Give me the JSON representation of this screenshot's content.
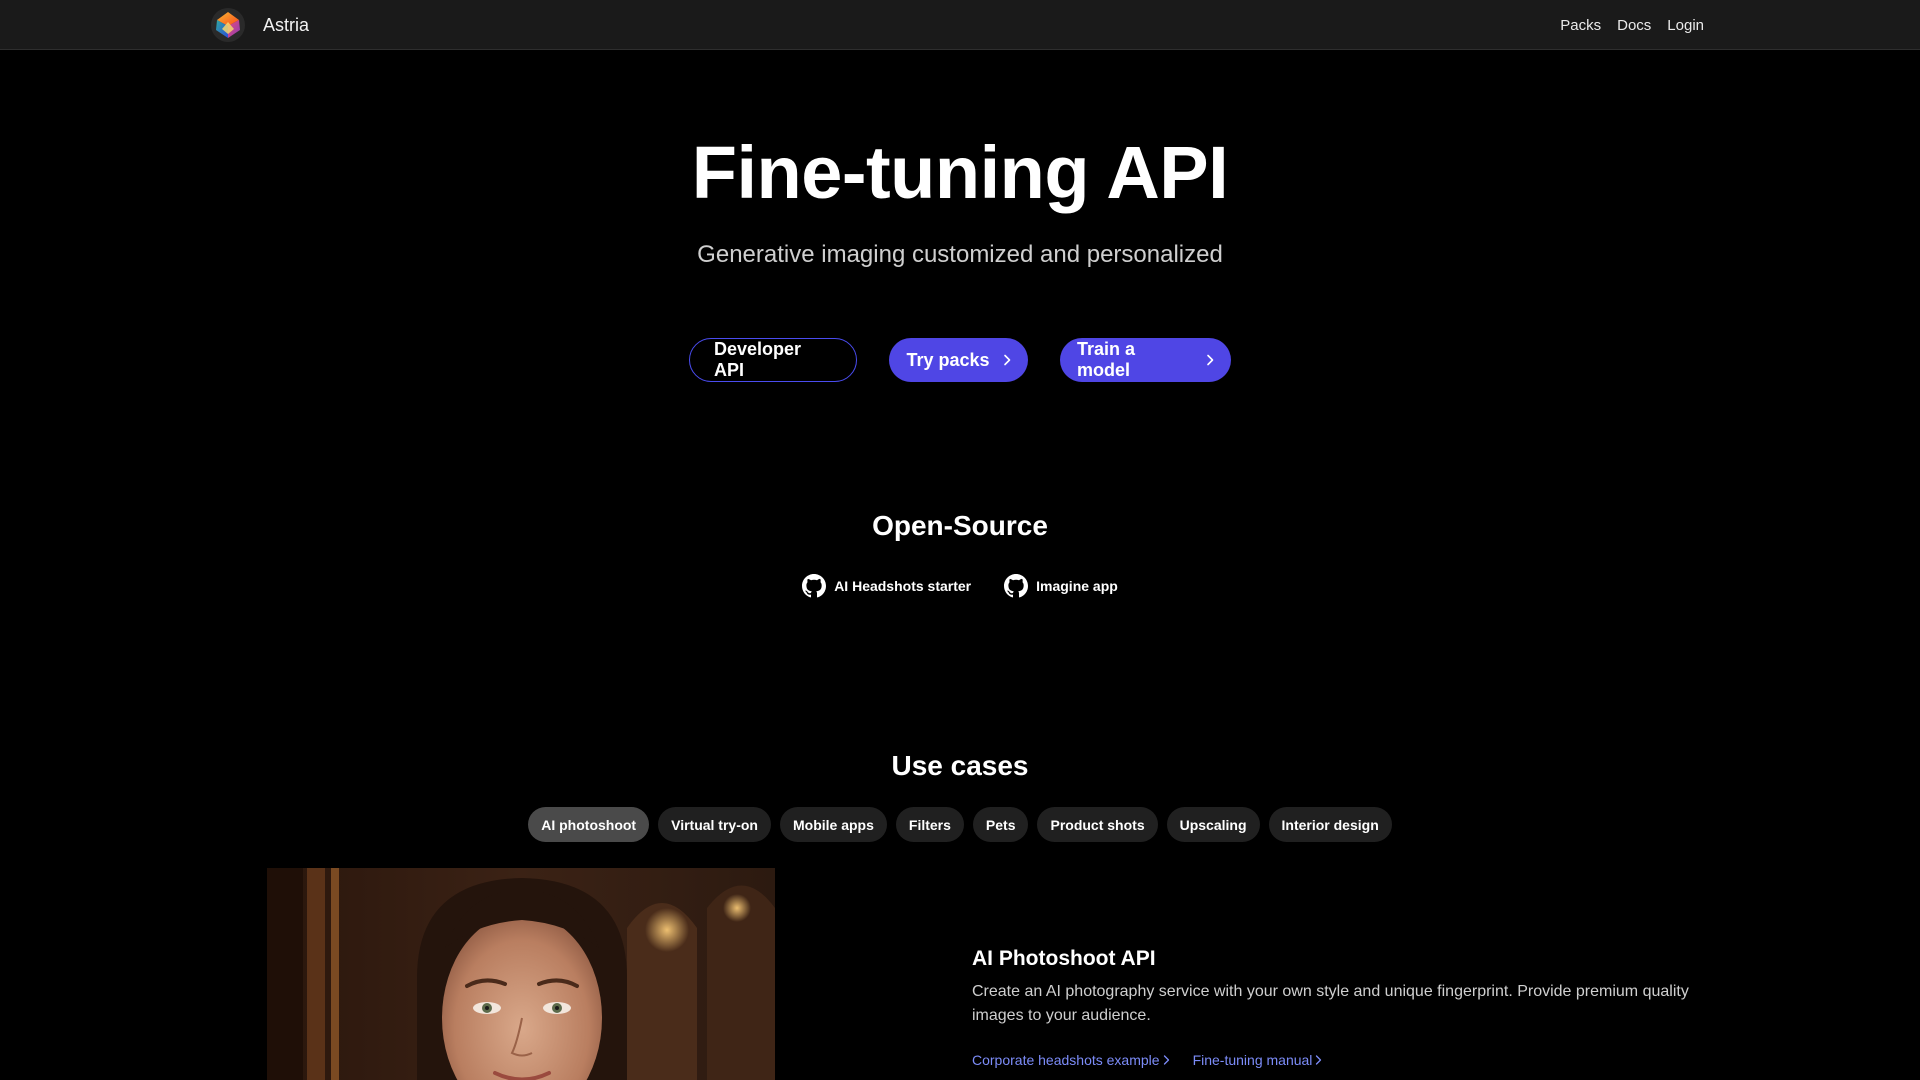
{
  "nav": {
    "brand": "Astria",
    "links": [
      {
        "label": "Packs"
      },
      {
        "label": "Docs"
      },
      {
        "label": "Login"
      }
    ]
  },
  "hero": {
    "title": "Fine-tuning API",
    "subtitle": "Generative imaging customized and personalized",
    "buttons": {
      "developer_api": "Developer API",
      "try_packs": "Try packs",
      "train_model": "Train a model"
    }
  },
  "open_source": {
    "title": "Open-Source",
    "links": [
      {
        "label": "AI Headshots starter",
        "icon": "github-icon"
      },
      {
        "label": "Imagine app",
        "icon": "github-icon"
      }
    ]
  },
  "use_cases": {
    "title": "Use cases",
    "tabs": [
      {
        "label": "AI photoshoot",
        "active": true
      },
      {
        "label": "Virtual try-on",
        "active": false
      },
      {
        "label": "Mobile apps",
        "active": false
      },
      {
        "label": "Filters",
        "active": false
      },
      {
        "label": "Pets",
        "active": false
      },
      {
        "label": "Product shots",
        "active": false
      },
      {
        "label": "Upscaling",
        "active": false
      },
      {
        "label": "Interior design",
        "active": false
      }
    ]
  },
  "feature": {
    "title": "AI Photoshoot API",
    "description": "Create an AI photography service with your own style and unique fingerprint. Provide premium quality images to your audience.",
    "links": [
      {
        "label": "Corporate headshots example"
      },
      {
        "label": "Fine-tuning manual"
      }
    ]
  },
  "colors": {
    "accent": "#4f46e5",
    "link": "#7c8cf8",
    "nav_bg": "#1a1a1a",
    "tab_bg": "#202020",
    "tab_active_bg": "#4a4a4a"
  }
}
